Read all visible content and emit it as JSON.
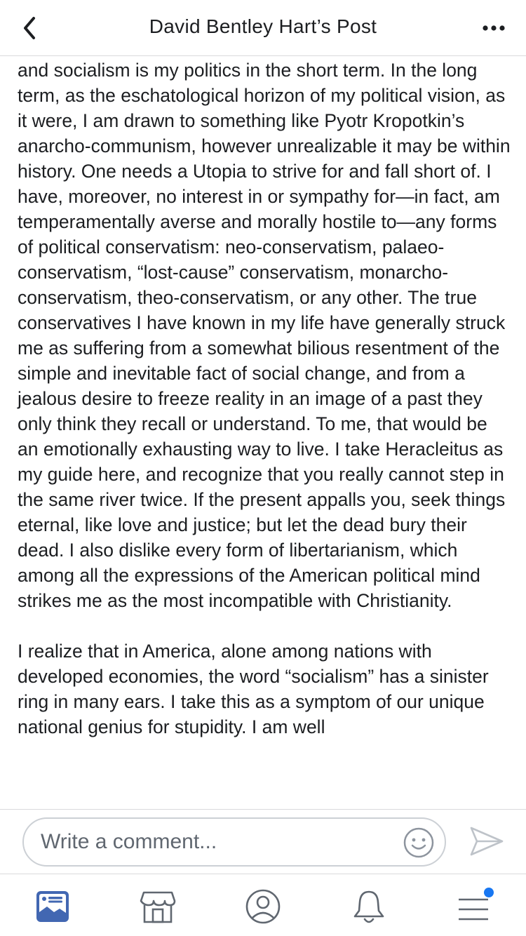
{
  "header": {
    "title": "David Bentley Hart’s Post",
    "back_icon": "chevron-left-icon",
    "more_icon": "more-dots-icon"
  },
  "post": {
    "paragraphs": [
      "and socialism is my politics in the short term.  In the long term, as the eschatological horizon of my political vision, as it were, I am drawn to something like Pyotr Kropotkin’s anarcho-communism, however unrealizable it may be within history.  One needs a Utopia to strive for and fall short of.  I have, moreover, no interest in or sympathy for—in fact, am temperamentally averse and morally hostile to—any forms of political conservatism: neo-conservatism, palaeo-conservatism, “lost-cause” conservatism, monarcho-conservatism, theo-conservatism, or any other.  The true conservatives I have known in my life have generally struck me as suffering from a somewhat bilious resentment of the simple and inevitable fact of social change, and from a jealous desire to freeze reality in an image of a past they only think they recall or understand.  To me, that would be an emotionally exhausting way to live.  I take Heracleitus as my guide here, and recognize that you really cannot step in the same river twice.  If the present appalls you, seek things eternal, like love and justice; but let the dead bury their dead.  I also dislike every form of libertarianism, which among all the expressions of the American political mind strikes me as the most incompatible with Christianity.",
      "I realize that in America, alone among nations with developed economies, the word “socialism” has a sinister ring in many ears.  I take this as a symptom of our unique national genius for stupidity.  I am well"
    ]
  },
  "comment": {
    "placeholder": "Write a comment...",
    "emoji_icon": "emoji-smile-icon",
    "send_icon": "send-icon"
  },
  "bottom_nav": {
    "items": [
      {
        "icon": "news-feed-icon",
        "active": true
      },
      {
        "icon": "marketplace-icon",
        "active": false
      },
      {
        "icon": "profile-icon",
        "active": false
      },
      {
        "icon": "notifications-bell-icon",
        "active": false
      },
      {
        "icon": "menu-icon",
        "active": false,
        "badge": true
      }
    ]
  },
  "colors": {
    "active": "#4267b2",
    "inactive": "#606770",
    "badge": "#1877f2"
  }
}
